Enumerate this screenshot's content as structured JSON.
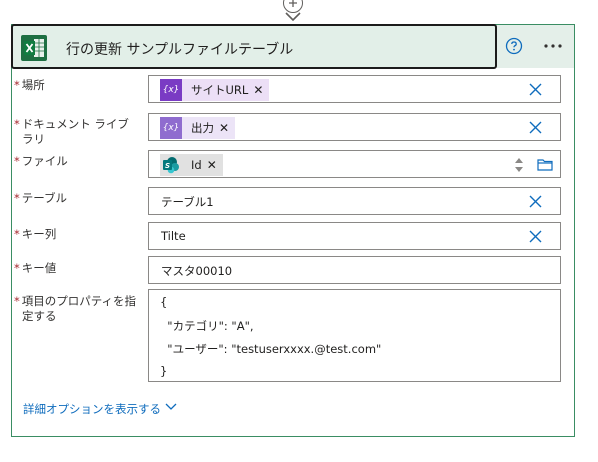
{
  "card": {
    "title": "行の更新 サンプルファイルテーブル",
    "accent_color": "#3a8d63",
    "icon": "excel-icon"
  },
  "fields": {
    "location": {
      "label": "場所",
      "token_text": "サイトURL",
      "token_icon_text": "{x}",
      "token_color": "#7a3bc4"
    },
    "document_library": {
      "label_line1": "ドキュメント ライブ",
      "label_line2": "ラリ",
      "token_text": "出力",
      "token_icon_text": "{x}",
      "token_color": "#8f6ccf"
    },
    "file": {
      "label": "ファイル",
      "token_text": "Id",
      "token_icon": "sharepoint-icon"
    },
    "table": {
      "label": "テーブル",
      "value": "テーブル1"
    },
    "key_column": {
      "label": "キー列",
      "value": "Tilte"
    },
    "key_value": {
      "label": "キー値",
      "value": "マスタ00010"
    },
    "item_properties": {
      "label_line1": "項目のプロパティを指",
      "label_line2": "定する",
      "lines": [
        "{",
        "  \"カテゴリ\": \"A\",",
        "  \"ユーザー\": \"testuserxxxx.@test.com\"",
        "}"
      ]
    }
  },
  "advanced": {
    "label": "詳細オプションを表示する"
  },
  "required_marker": "*"
}
